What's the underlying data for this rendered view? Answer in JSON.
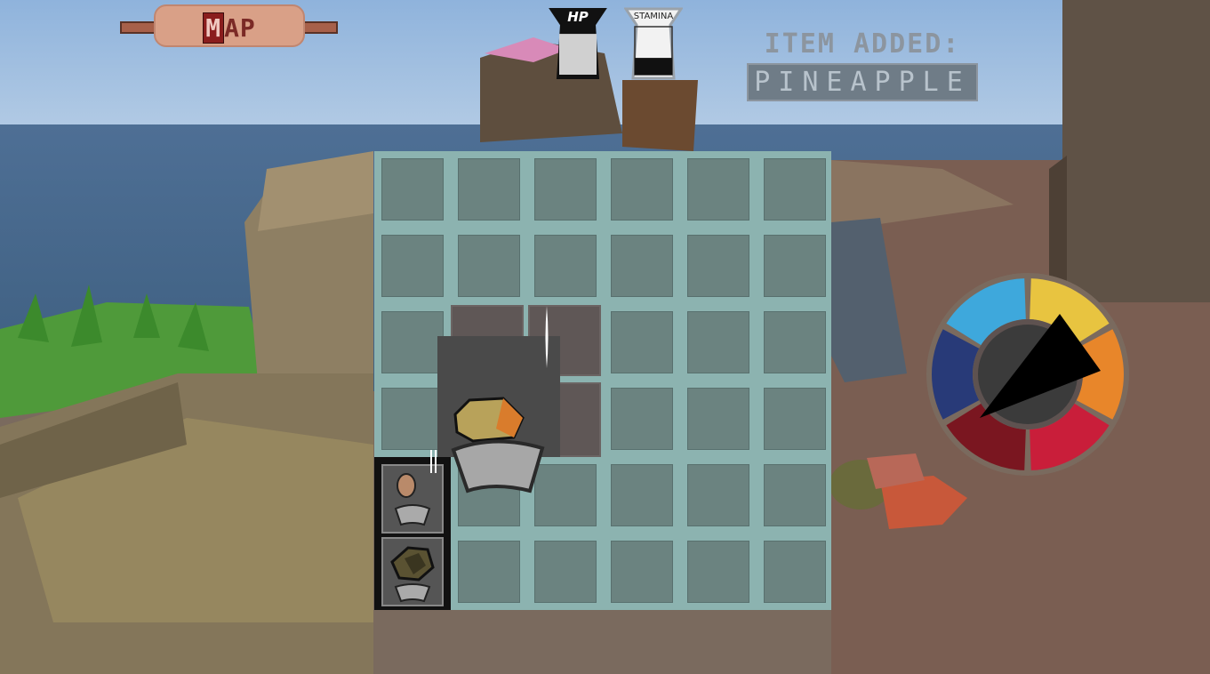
{
  "hud": {
    "map_button": {
      "label_first": "M",
      "label_rest": "AP"
    },
    "hp": {
      "label": "HP",
      "level": 0.85,
      "fill_color": "#d0d0d0"
    },
    "stamina": {
      "label": "STAMINA",
      "level": 0.35,
      "fill_color": "#111111"
    },
    "notification": {
      "title": "ITEM ADDED:",
      "item": "PINEAPPLE"
    }
  },
  "inventory": {
    "rows": 6,
    "cols": 6,
    "slot_color": "#6b8380",
    "grid_color": "#8cb3b0",
    "held_item": "gold-ore-icon",
    "quickbar_items": [
      "potato-icon",
      "coconut-icon"
    ]
  },
  "compass_wheel": {
    "segments": [
      "yellow",
      "orange",
      "red",
      "dark-red",
      "navy",
      "light-blue"
    ],
    "colors": [
      "#e8c440",
      "#e8862a",
      "#c91e3a",
      "#7a1620",
      "#283a78",
      "#3ea8dc"
    ]
  }
}
